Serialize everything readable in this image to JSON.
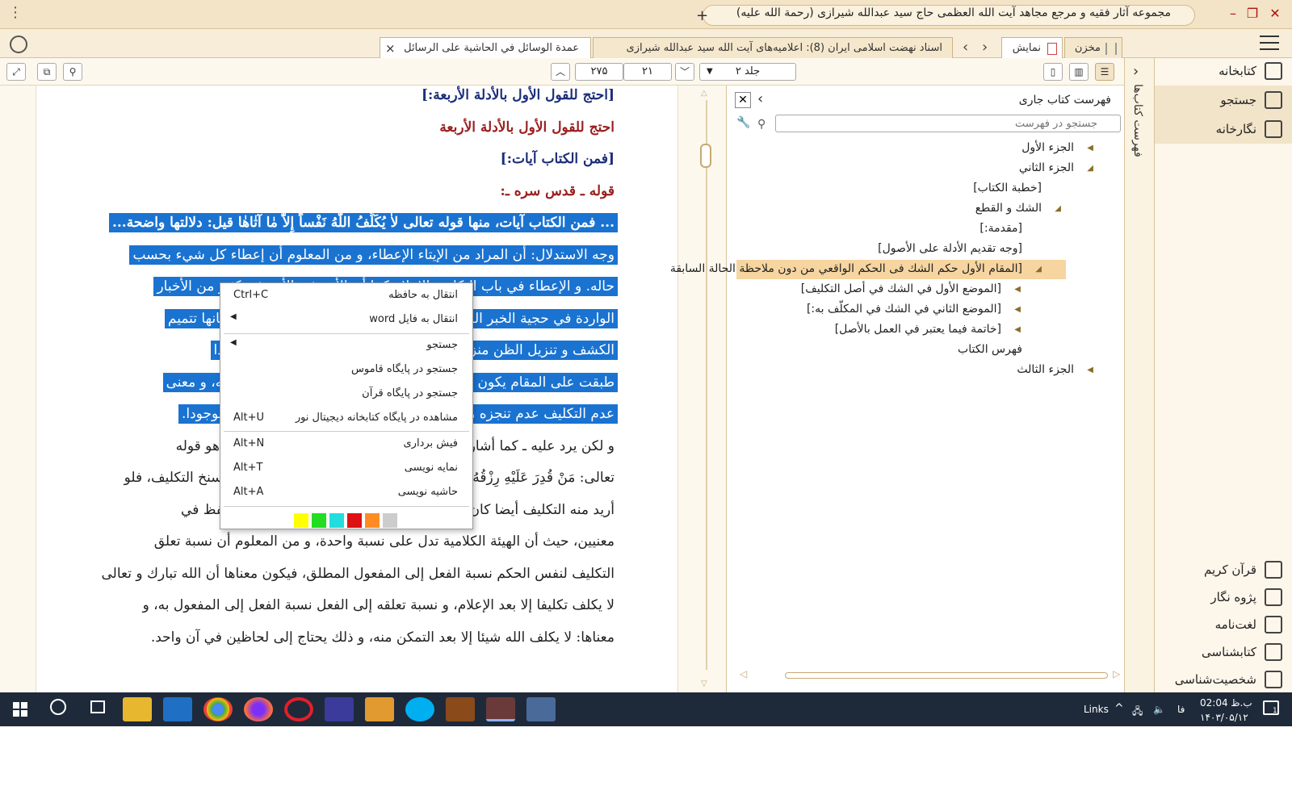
{
  "window": {
    "title": "مجموعه آثار فقیه و مرجع مجاهد آیت الله العظمی حاج سید عبدالله شیرازی (رحمة الله علیه)",
    "new_tab": "+",
    "menu_dots": "⋮",
    "minimize": "–",
    "maximize": "❐",
    "close": "✕"
  },
  "tabs": [
    {
      "label": "عمدة الوسائل في الحاشية على الرسائل",
      "close": "×"
    },
    {
      "label": "اسناد نهضت اسلامی ایران (8): اعلامیه‌های آیت الله سید عبدالله شیرازی"
    },
    {
      "label": "نمایش"
    },
    {
      "label": "مخزن"
    }
  ],
  "toolbar": {
    "volume": "جلد ۲",
    "page": "۲۱",
    "total": "۲۷۵"
  },
  "reader": {
    "lines": [
      {
        "text": "[احتج للقول الأول بالأدلة الأربعة:]",
        "style": "blue"
      },
      {
        "text": "احتج للقول الأول بالأدلة الأربعة",
        "style": "red"
      },
      {
        "text": "[فمن الكتاب آيات:]",
        "style": "blue"
      },
      {
        "text": "قوله ـ قدس سره ـ:",
        "style": "red"
      },
      {
        "text": "... فمن الكتاب آيات، منها قوله تعالى لاٰ يُكَلِّفُ اللّٰهُ نَفْساً إِلاّٰ مٰا آتٰاهٰا قيل: دلالتها واضحة...",
        "style": "hl-bold"
      },
      {
        "text": "وجه الاستدلال: أن المراد من الإيتاء الإعطاء، و من المعلوم أن إعطاء كل شيء بحسب",
        "style": "hl"
      },
      {
        "text": "حاله. و الإعطاء في باب التكليف الإعلام كما أن الأمر فيه الأمر في كثير من الأخبار",
        "style": "hl"
      },
      {
        "text": "الواردة في حجية الخبر الواحد و الظن الذي يكون مفاده بالقول بأن لسانها تتميم",
        "style": "hl"
      },
      {
        "text": "الكشف و تنزيل الظن منزلة العلم و العلم كذلك يكون منزلة الواقع، فإذا",
        "style": "hl"
      },
      {
        "text": "طبقت على المقام يكون الإعطاء من العبد بالنسبة إلى الإعلام من جانبه، و معنى",
        "style": "hl"
      },
      {
        "text": "عدم التكليف عدم تنجزه مع عدم الإعلام و إن كان التكليف في الواقع موجودا.",
        "style": "hl"
      },
      {
        "text": "و لكن يرد عليه ـ كما أشار إليه الشيخ ـ أن ذلك مخالف لقرينة الصدر و هو قوله",
        "style": "normal"
      },
      {
        "text": "تعالى: مَنْ قُدِرَ عَلَيْهِ رِزْقُهُ فَلْيُنْفِقْ مِمّٰا آتٰاهُ اللّٰهُ، فإن الإيتاء فيه من غير سنخ التكليف، فلو",
        "style": "normal"
      },
      {
        "text": "أريد منه التكليف أيضا كان المراد منه المعنى الأعم، و لزم استعمال اللفظ في",
        "style": "normal"
      },
      {
        "text": "معنيين، حيث أن الهيئة الكلامية تدل على نسبة واحدة، و من المعلوم أن نسبة تعلق",
        "style": "normal"
      },
      {
        "text": "التكليف لنفس الحكم نسبة الفعل إلى المفعول المطلق، فيكون معناها أن الله تبارك و تعالى",
        "style": "normal"
      },
      {
        "text": "لا يكلف تكليفا إلا بعد الإعلام، و نسبة تعلقه إلى الفعل نسبة الفعل إلى المفعول به، و",
        "style": "normal"
      },
      {
        "text": "معناها: لا يكلف الله شيئا إلا بعد التمكن منه، و ذلك يحتاج إلى لحاظين في آن واحد.",
        "style": "normal"
      }
    ]
  },
  "context_menu": {
    "items": [
      {
        "label": "انتقال به حافظه",
        "shortcut": "Ctrl+C"
      },
      {
        "label": "انتقال به فایل word",
        "shortcut": "◀"
      },
      {
        "label": "جستجو",
        "shortcut": "◀"
      },
      {
        "label": "جستجو در پایگاه قاموس",
        "shortcut": ""
      },
      {
        "label": "جستجو در پایگاه قرآن",
        "shortcut": ""
      },
      {
        "label": "مشاهده در پایگاه کتابخانه دیجیتال نور",
        "shortcut": "Alt+U"
      },
      {
        "label": "فیش برداری",
        "shortcut": "Alt+N"
      },
      {
        "label": "نمایه نویسی",
        "shortcut": "Alt+T"
      },
      {
        "label": "حاشیه نویسی",
        "shortcut": "Alt+A"
      }
    ],
    "colors": [
      "#ffff00",
      "#22dd22",
      "#22dddd",
      "#dd1111",
      "#ff8c22",
      "#cccccc"
    ]
  },
  "toc": {
    "title": "فهرست کتاب جاری",
    "search_placeholder": "جستجو در فهرست",
    "items": [
      {
        "label": "الجزء الأول",
        "level": 0,
        "tri": "◀"
      },
      {
        "label": "الجزء الثاني",
        "level": 0,
        "tri": "◢"
      },
      {
        "label": "[خطبة الكتاب]",
        "level": 1,
        "tri": ""
      },
      {
        "label": "الشك و القطع",
        "level": 1,
        "tri": "◢"
      },
      {
        "label": "[مقدمة:]",
        "level": 2,
        "tri": ""
      },
      {
        "label": "[وجه تقديم الأدلة على الأصول]",
        "level": 2,
        "tri": ""
      },
      {
        "label": "[المقام الأول حكم الشك فى الحكم الواقعي من دون ملاحظة الحالة السابقة",
        "level": 2,
        "tri": "◢",
        "selected": true
      },
      {
        "label": "[الموضع الأول في الشك في أصل التكليف]",
        "level": 3,
        "tri": "◀"
      },
      {
        "label": "[الموضع الثاني في الشك في المكلّف به:]",
        "level": 3,
        "tri": "◀"
      },
      {
        "label": "[خاتمة فيما يعتبر في العمل بالأصل]",
        "level": 3,
        "tri": "◀"
      },
      {
        "label": "فهرس الكتاب",
        "level": 2,
        "tri": ""
      },
      {
        "label": "الجزء الثالث",
        "level": 0,
        "tri": "◀"
      }
    ]
  },
  "sidebar": {
    "strip_label": "فهرست کتاب‌ها",
    "top_items": [
      {
        "label": "کتابخانه",
        "icon": "library-icon"
      },
      {
        "label": "جستجو",
        "icon": "search-icon"
      },
      {
        "label": "نگارخانه",
        "icon": "gallery-icon"
      }
    ],
    "bottom_items": [
      {
        "label": "قرآن کریم",
        "icon": "quran-icon"
      },
      {
        "label": "پژوه نگار",
        "icon": "research-icon"
      },
      {
        "label": "لغت‌نامه",
        "icon": "dictionary-icon"
      },
      {
        "label": "کتابشناسی",
        "icon": "bibliography-icon"
      },
      {
        "label": "شخصیت‌شناسی",
        "icon": "person-icon"
      }
    ]
  },
  "taskbar": {
    "links": "Links",
    "lang": "فا",
    "time": "ب.ظ 02:04",
    "date": "۱۴۰۳/۰۵/۱۲",
    "notif_count": "1"
  },
  "colors": {
    "selection": "#1a73d1",
    "toc_selected": "#f7d5a0",
    "accent": "#b01010"
  }
}
